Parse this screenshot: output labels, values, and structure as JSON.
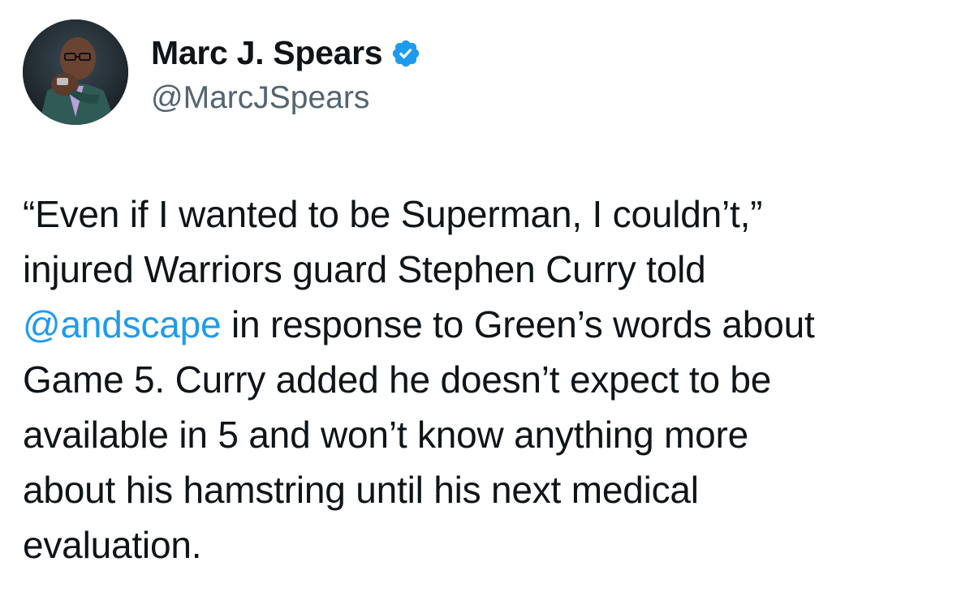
{
  "author": {
    "display_name": "Marc J. Spears",
    "handle": "@MarcJSpears",
    "verified": true,
    "verified_icon": "verified-badge-icon",
    "verified_color": "#1d9bf0"
  },
  "tweet": {
    "line_1": "“Even if I wanted to be Superman, I couldn’t,”",
    "line_2": "injured Warriors guard Stephen Curry told",
    "line_3_mention": "@andscape",
    "line_3_rest": " in response to Green’s words about",
    "line_4": "Game 5. Curry added he doesn’t expect to be",
    "line_5": "available in 5 and won’t know anything more",
    "line_6": "about his hamstring until his next medical",
    "line_7": "evaluation."
  },
  "colors": {
    "text_primary": "#0f1419",
    "text_secondary": "#536471",
    "link": "#1d9bf0"
  }
}
